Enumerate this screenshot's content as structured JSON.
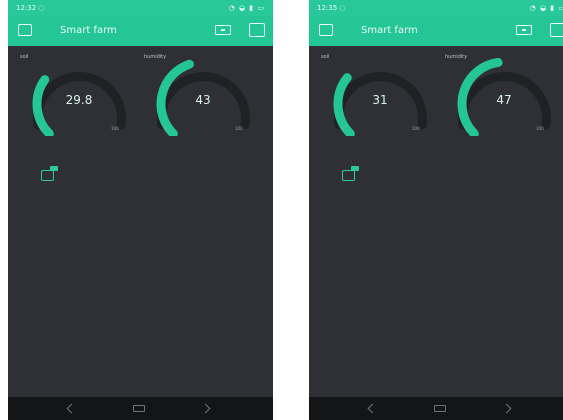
{
  "screens": [
    {
      "status": {
        "time": "12:32 ◌",
        "icons": "◔ ◒ ▮ ▭"
      },
      "header": {
        "title": "Smart farm"
      },
      "gauges": [
        {
          "label": "soil",
          "value": "29.8",
          "min": "0",
          "max": "100",
          "level": 0.298
        },
        {
          "label": "humidity",
          "value": "43",
          "min": "0",
          "max": "100",
          "level": 0.43
        }
      ],
      "widget_icon": "widget-device-icon"
    },
    {
      "status": {
        "time": "12:35 ◌",
        "icons": "◔ ◒ ▮ ▭"
      },
      "header": {
        "title": "Smart farm"
      },
      "gauges": [
        {
          "label": "soil",
          "value": "31",
          "min": "0",
          "max": "100",
          "level": 0.31
        },
        {
          "label": "humidity",
          "value": "47",
          "min": "0",
          "max": "100",
          "level": 0.47
        }
      ],
      "widget_icon": "widget-device-icon"
    }
  ],
  "colors": {
    "accent": "#23c694",
    "background": "#2e3035",
    "gauge_track": "#1f2125",
    "nav_bar": "#141516"
  }
}
